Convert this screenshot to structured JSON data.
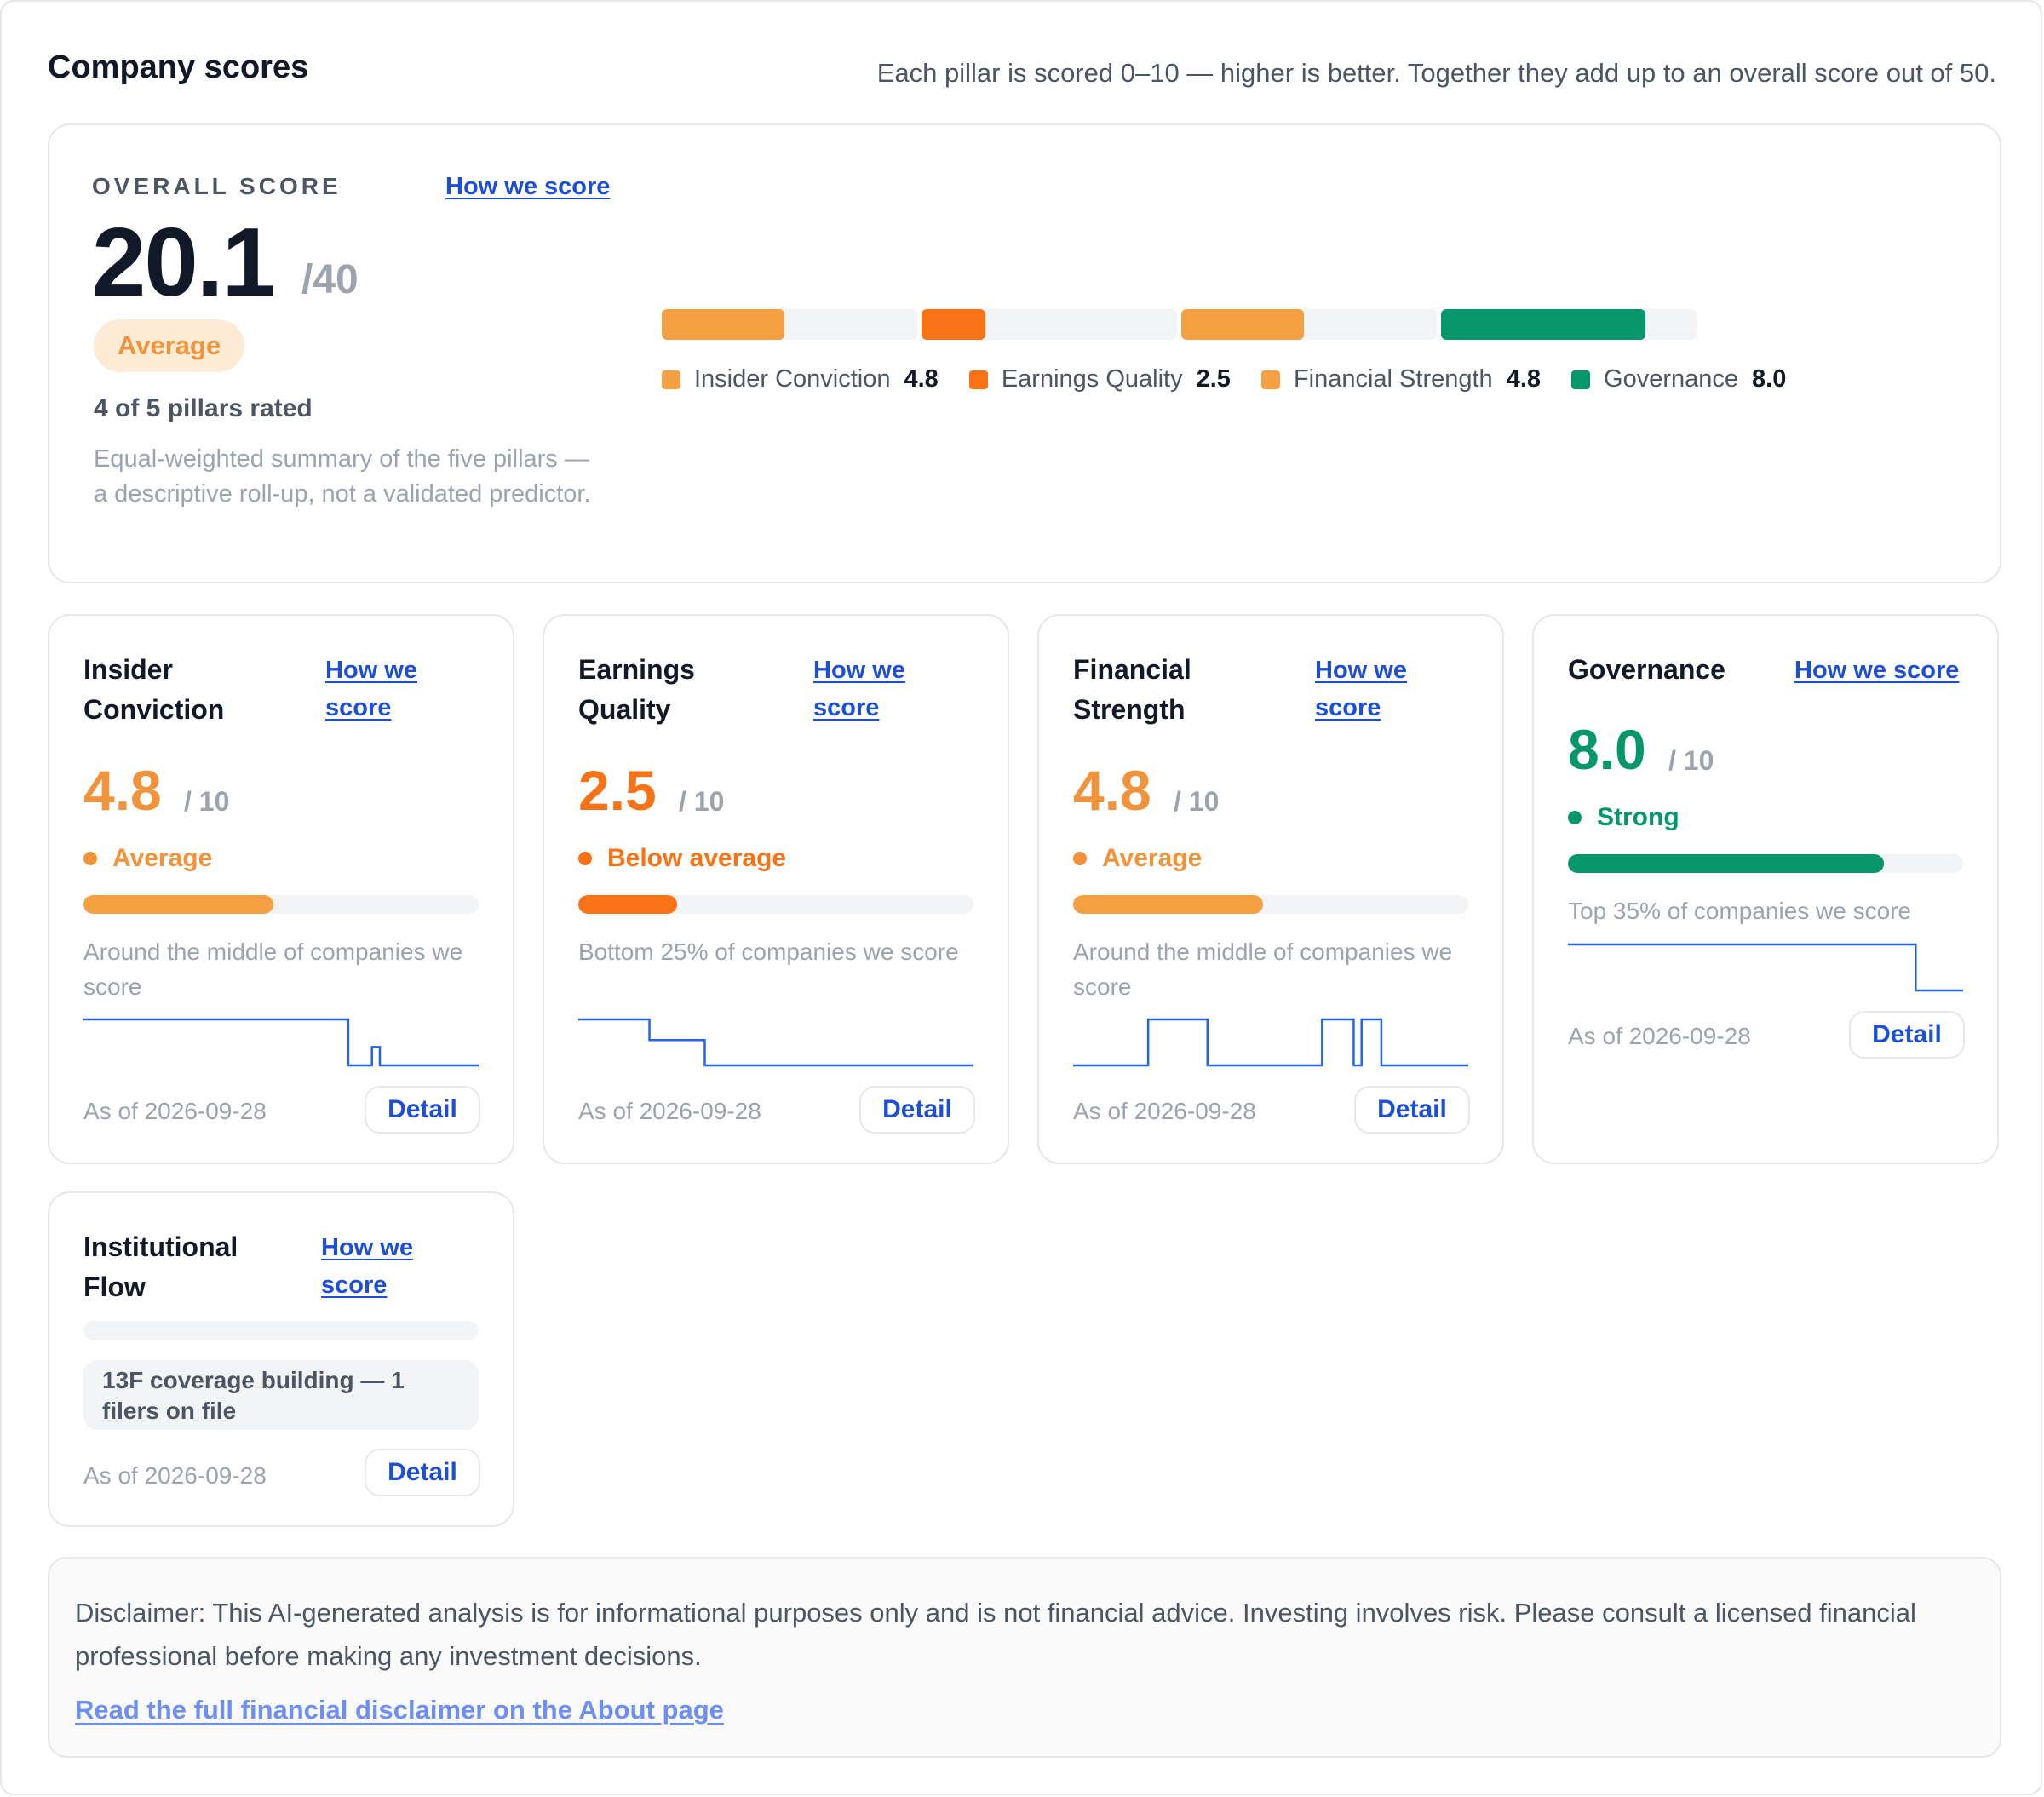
{
  "header": {
    "title": "Company scores",
    "subtitle": "Each pillar is scored 0–10 — higher is better. Together they add up to an overall score out of 50."
  },
  "colors": {
    "average": "#f5a042",
    "below_average": "#f97316",
    "strong": "#059669",
    "link": "#1d4ed8",
    "sparkline": "#2563eb",
    "track": "#f3f4f6"
  },
  "overall": {
    "label": "OVERALL SCORE",
    "how_link": "How we score",
    "score": "20.1",
    "out_of": "/40",
    "badge": "Average",
    "rated": "4 of 5 pillars rated",
    "description": "Equal-weighted summary of the five pillars — a descriptive roll-up, not a validated predictor.",
    "segments": [
      {
        "name": "Insider Conviction",
        "value": "4.8",
        "fraction": 0.48,
        "color": "#f5a042"
      },
      {
        "name": "Earnings Quality",
        "value": "2.5",
        "fraction": 0.25,
        "color": "#f97316"
      },
      {
        "name": "Financial Strength",
        "value": "4.8",
        "fraction": 0.48,
        "color": "#f5a042"
      },
      {
        "name": "Governance",
        "value": "8.0",
        "fraction": 0.8,
        "color": "#059669"
      }
    ]
  },
  "pillars": [
    {
      "title": "Insider Conviction",
      "how_link": "How we score",
      "score": "4.8",
      "out_of": "/ 10",
      "status": "Average",
      "status_color": "#f5a042",
      "fraction": 0.48,
      "note": "Around the middle of companies we score",
      "as_of": "As of 2026-09-28",
      "detail": "Detail",
      "sparkline": [
        1,
        1,
        1,
        1,
        1,
        1,
        1,
        1,
        1,
        1,
        1,
        1,
        1,
        1,
        1,
        1,
        1,
        1,
        1,
        1,
        1,
        1,
        1,
        1,
        1,
        1,
        1,
        1,
        1,
        1,
        1,
        1,
        1,
        1,
        1,
        1,
        1,
        1,
        1,
        1,
        1,
        1,
        1,
        1,
        1,
        1,
        1,
        1,
        1,
        1,
        1,
        1,
        1,
        1,
        1,
        1,
        1,
        1,
        1,
        1,
        1,
        1,
        1,
        1,
        1,
        1,
        1,
        0,
        0,
        0,
        0,
        0,
        0,
        0.4,
        0.4,
        0,
        0,
        0,
        0,
        0,
        0,
        0,
        0,
        0,
        0,
        0,
        0,
        0,
        0,
        0,
        0,
        0,
        0,
        0,
        0,
        0,
        0,
        0,
        0,
        0
      ]
    },
    {
      "title": "Earnings Quality",
      "how_link": "How we score",
      "score": "2.5",
      "out_of": "/ 10",
      "status": "Below average",
      "status_color": "#f97316",
      "fraction": 0.25,
      "note": "Bottom 25% of companies we score",
      "as_of": "As of 2026-09-28",
      "detail": "Detail",
      "sparkline": [
        1,
        1,
        1,
        1,
        1,
        1,
        1,
        1,
        1,
        1,
        1,
        1,
        1,
        1,
        1,
        1,
        1,
        1,
        0.55,
        0.55,
        0.55,
        0.55,
        0.55,
        0.55,
        0.55,
        0.55,
        0.55,
        0.55,
        0.55,
        0.55,
        0.55,
        0.55,
        0,
        0,
        0,
        0,
        0,
        0,
        0,
        0,
        0,
        0,
        0,
        0,
        0,
        0,
        0,
        0,
        0,
        0,
        0,
        0,
        0,
        0,
        0,
        0,
        0,
        0,
        0,
        0,
        0,
        0,
        0,
        0,
        0,
        0,
        0,
        0,
        0,
        0,
        0,
        0,
        0,
        0,
        0,
        0,
        0,
        0,
        0,
        0,
        0,
        0,
        0,
        0,
        0,
        0,
        0,
        0,
        0,
        0,
        0,
        0,
        0,
        0,
        0,
        0,
        0,
        0,
        0,
        0
      ]
    },
    {
      "title": "Financial Strength",
      "how_link": "How we score",
      "score": "4.8",
      "out_of": "/ 10",
      "status": "Average",
      "status_color": "#f5a042",
      "fraction": 0.48,
      "note": "Around the middle of companies we score",
      "as_of": "As of 2026-09-28",
      "detail": "Detail",
      "sparkline": [
        0,
        0,
        0,
        0,
        0,
        0,
        0,
        0,
        0,
        0,
        0,
        0,
        0,
        0,
        0,
        0,
        0,
        0,
        0,
        1,
        1,
        1,
        1,
        1,
        1,
        1,
        1,
        1,
        1,
        1,
        1,
        1,
        1,
        1,
        0,
        0,
        0,
        0,
        0,
        0,
        0,
        0,
        0,
        0,
        0,
        0,
        0,
        0,
        0,
        0,
        0,
        0,
        0,
        0,
        0,
        0,
        0,
        0,
        0,
        0,
        0,
        0,
        0,
        1,
        1,
        1,
        1,
        1,
        1,
        1,
        1,
        0,
        0,
        1,
        1,
        1,
        1,
        1,
        0,
        0,
        0,
        0,
        0,
        0,
        0,
        0,
        0,
        0,
        0,
        0,
        0,
        0,
        0,
        0,
        0,
        0,
        0,
        0,
        0,
        0
      ]
    },
    {
      "title": "Governance",
      "how_link": "How we score",
      "score": "8.0",
      "out_of": "/ 10",
      "status": "Strong",
      "status_color": "#059669",
      "fraction": 0.8,
      "note": "Top 35% of companies we score",
      "as_of": "As of 2026-09-28",
      "detail": "Detail",
      "sparkline": [
        1,
        1,
        1,
        1,
        1,
        1,
        1,
        1,
        1,
        1,
        1,
        1,
        1,
        1,
        1,
        1,
        1,
        1,
        1,
        1,
        1,
        1,
        1,
        1,
        1,
        1,
        1,
        1,
        1,
        1,
        1,
        1,
        1,
        1,
        1,
        1,
        1,
        1,
        1,
        1,
        1,
        1,
        1,
        1,
        1,
        1,
        1,
        1,
        1,
        1,
        1,
        1,
        1,
        1,
        1,
        1,
        1,
        1,
        1,
        1,
        1,
        1,
        1,
        1,
        1,
        1,
        1,
        1,
        1,
        1,
        1,
        1,
        1,
        1,
        1,
        1,
        1,
        1,
        1,
        1,
        1,
        1,
        1,
        1,
        1,
        1,
        1,
        1,
        0,
        0,
        0,
        0,
        0,
        0,
        0,
        0,
        0,
        0,
        0,
        0
      ]
    },
    {
      "title": "Institutional Flow",
      "how_link": "How we score",
      "coverage_note": "13F coverage building — 1 filers on file",
      "as_of": "As of 2026-09-28",
      "detail": "Detail"
    }
  ],
  "disclaimer": {
    "text": "Disclaimer: This AI-generated analysis is for informational purposes only and is not financial advice. Investing involves risk. Please consult a licensed financial professional before making any investment decisions.",
    "link": "Read the full financial disclaimer on the About page"
  }
}
